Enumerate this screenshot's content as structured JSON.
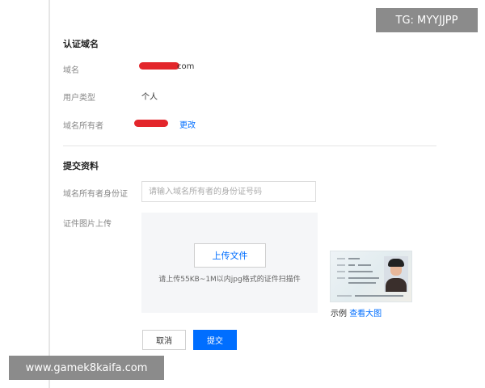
{
  "domain_section": {
    "title": "认证域名",
    "domain_label": "域名",
    "domain_value_suffix": "com",
    "user_type_label": "用户类型",
    "user_type_value": "个人",
    "owner_label": "域名所有者",
    "change_link": "更改"
  },
  "submit_section": {
    "title": "提交资料",
    "id_label": "域名所有者身份证",
    "id_placeholder": "请输入域名所有者的身份证号码",
    "id_value": "",
    "cert_label": "证件图片上传",
    "upload_button": "上传文件",
    "upload_hint": "请上传55KB~1M以内jpg格式的证件扫描件",
    "example_label": "示例",
    "view_large_link": "查看大图"
  },
  "actions": {
    "cancel": "取消",
    "submit": "提交"
  },
  "overlays": {
    "tg": "TG: MYYJJPP",
    "site": "www.gamek8kaifa.com"
  },
  "colors": {
    "accent": "#006eff",
    "redaction": "#e3262b"
  }
}
